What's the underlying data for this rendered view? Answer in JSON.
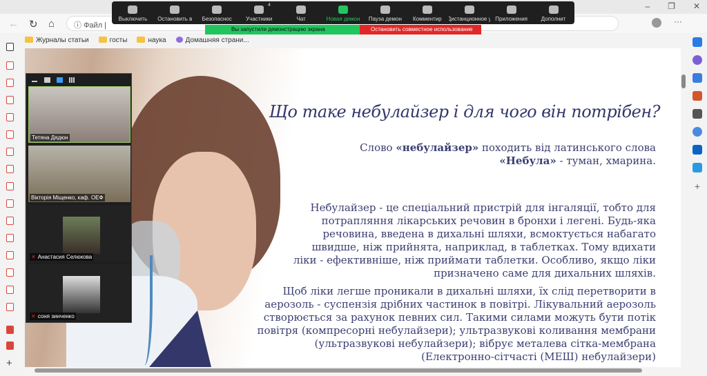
{
  "browser": {
    "url_label": "Файл",
    "bookmarks": [
      "Журналы статьи",
      "госты",
      "наука",
      "Домашняя страни..."
    ]
  },
  "zoom": {
    "toolbar": [
      {
        "label": "Выключить",
        "icon": "microphone-icon"
      },
      {
        "label": "Остановить в",
        "icon": "video-camera-icon"
      },
      {
        "label": "Безопаснос",
        "icon": "shield-icon"
      },
      {
        "label": "Участники",
        "icon": "participants-icon",
        "count": "4"
      },
      {
        "label": "Чат",
        "icon": "chat-icon"
      },
      {
        "label": "Новая демон",
        "icon": "share-screen-icon"
      },
      {
        "label": "Пауза демон",
        "icon": "pause-icon"
      },
      {
        "label": "Комментир",
        "icon": "pencil-icon"
      },
      {
        "label": "Дистанционное у",
        "icon": "mouse-icon"
      },
      {
        "label": "Приложения",
        "icon": "apps-icon"
      },
      {
        "label": "Дополнит",
        "icon": "more-icon"
      }
    ],
    "share_status": "Вы запустили демонстрацию экрана",
    "stop_share": "Остановить совместное использование",
    "participants": [
      "Тетяна Дядюн",
      "Вікторія  Міщенко, каф. ОЕФ",
      "Анастасия Селюкова",
      "соня зинченко"
    ],
    "colors": {
      "share_green": "#21c55d",
      "stop_red": "#e02828"
    }
  },
  "slide": {
    "title": "Що таке небулайзер і для чого він потрібен?",
    "p1_pre": "Слово ",
    "p1_b1": "«небулайзер»",
    "p1_mid": " походить від латинського слова",
    "p1_b2": "«Небула»",
    "p1_post": " - туман, хмарина.",
    "p2": "Небулайзер - це спеціальний пристрій для інгаляції, тобто для потрапляння лікарських речовин в бронхи і легені. Будь-яка речовина, введена в дихальні шляхи, всмоктується набагато швидше, ніж прийнята, наприклад, в таблетках. Тому вдихати ліки - ефективніше, ніж приймати таблетки. Особливо, якщо ліки призначено саме для дихальних шляхів.",
    "p3": "Щоб ліки легше проникали в дихальні шляхи, їх слід перетворити в аерозоль - суспензія дрібних частинок в повітрі. Лікувальний аерозоль створюється за рахунок певних сил. Такими силами можуть бути потік повітря (компресорні небулайзери); ультразвукові коливання мембрани (ультразвукові небулайзери); вібрує металева сітка-мембрана (Електронно-сітчасті (МЕШ) небулайзери)",
    "text_color": "#33376a"
  }
}
